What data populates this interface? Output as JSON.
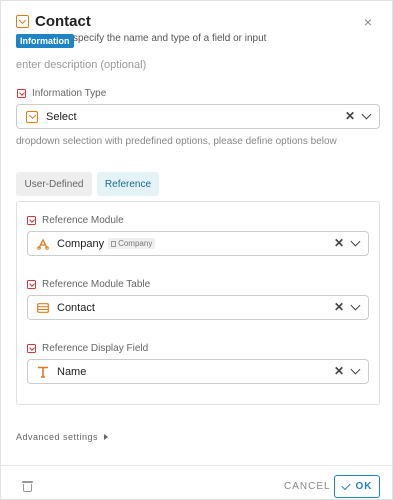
{
  "dialog": {
    "title": "Contact",
    "badge": "Information",
    "subtitle": "specify the name and type of a field or input",
    "description_placeholder": "enter description (optional)",
    "close_symbol": "×"
  },
  "information_type": {
    "label": "Information Type",
    "value": "Select",
    "hint": "dropdown selection with predefined options, please define options below"
  },
  "tabs": [
    {
      "label": "User-Defined",
      "active": false
    },
    {
      "label": "Reference",
      "active": true
    }
  ],
  "reference": {
    "module": {
      "label": "Reference Module",
      "value": "Company",
      "tag": "Company"
    },
    "table": {
      "label": "Reference Module Table",
      "value": "Contact"
    },
    "display_field": {
      "label": "Reference Display Field",
      "value": "Name"
    }
  },
  "advanced": {
    "label": "Advanced settings"
  },
  "footer": {
    "cancel": "CANCEL",
    "ok": "OK"
  },
  "colors": {
    "accent": "#1f84c5",
    "orange": "#e07b1a",
    "required": "#d23b3b"
  }
}
